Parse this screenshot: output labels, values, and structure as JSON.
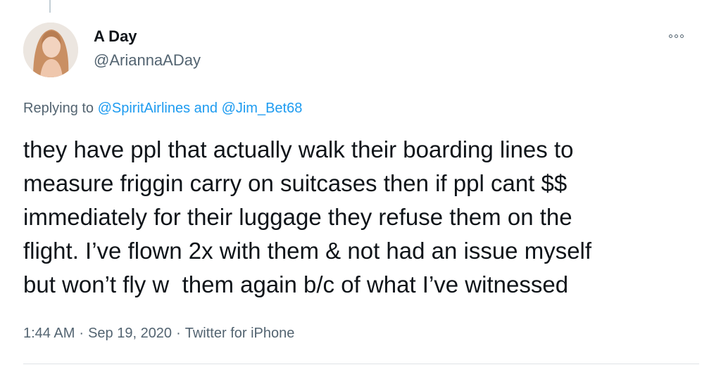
{
  "tweet": {
    "display_name": "A Day",
    "handle": "@AriannaADay",
    "replying": {
      "prefix": "Replying to ",
      "user1": "@SpiritAirlines",
      "conjunction": " and ",
      "user2": "@Jim_Bet68"
    },
    "body_lines": [
      "they have ppl that actually walk their boarding lines to",
      "measure friggin carry on suitcases then if ppl cant $$",
      "immediately for their luggage they refuse them on the",
      "flight. I’ve flown 2x with them & not had an issue myself",
      "but won’t fly w  them again b/c of what I’ve witnessed"
    ],
    "time": "1:44 AM",
    "date": "Sep 19, 2020",
    "source": "Twitter for iPhone",
    "separator": "·"
  },
  "icons": {
    "more": "more-options-icon",
    "avatar": "profile-photo"
  },
  "colors": {
    "link": "#1d9bf0",
    "secondary_text": "#536471",
    "primary_text": "#0f1419"
  }
}
